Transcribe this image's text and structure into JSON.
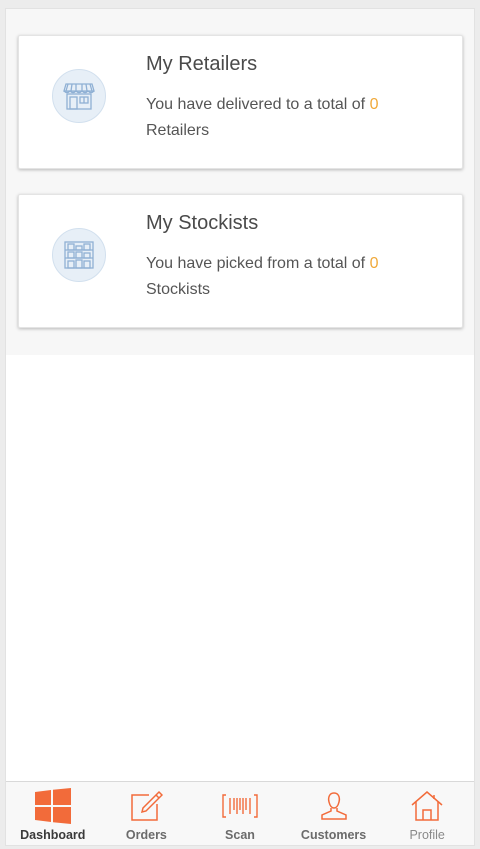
{
  "cards": {
    "retailers": {
      "title": "My Retailers",
      "text_prefix": "You have delivered to a total of",
      "count": "0",
      "text_suffix": "Retailers",
      "icon": "store-icon"
    },
    "stockists": {
      "title": "My Stockists",
      "text_prefix": "You have picked from a total of",
      "count": "0",
      "text_suffix": "Stockists",
      "icon": "warehouse-shelves-icon"
    }
  },
  "tabbar": {
    "tabs": [
      {
        "label": "Dashboard",
        "icon": "windows-tiles-icon",
        "active": true
      },
      {
        "label": "Orders",
        "icon": "edit-note-icon",
        "active": false
      },
      {
        "label": "Scan",
        "icon": "barcode-icon",
        "active": false
      },
      {
        "label": "Customers",
        "icon": "person-icon",
        "active": false
      },
      {
        "label": "Profile",
        "icon": "home-icon",
        "active": false
      }
    ]
  },
  "colors": {
    "accent": "#f26b3a",
    "count": "#f0a93a",
    "icon_bg": "#e7eff7",
    "icon_line": "#8fb0d4"
  }
}
